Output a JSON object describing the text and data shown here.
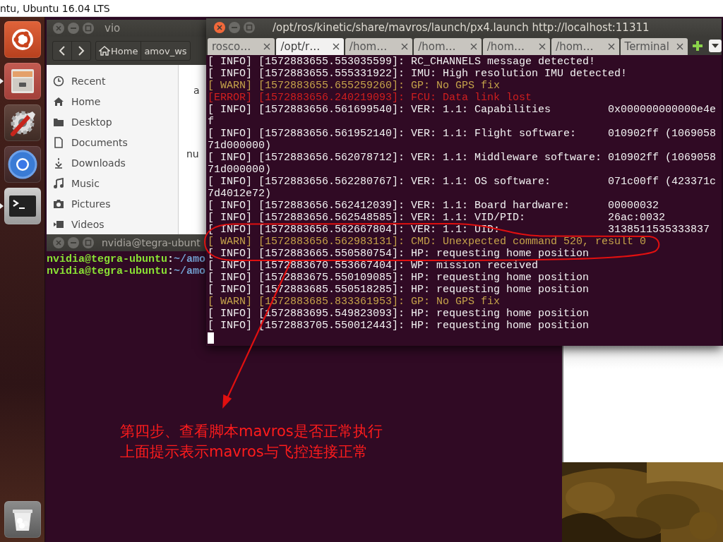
{
  "top_bar": {
    "title": "ntu, Ubuntu 16.04 LTS"
  },
  "launcher": {
    "items": [
      {
        "kind": "logo",
        "running": false
      },
      {
        "kind": "files",
        "running": true
      },
      {
        "kind": "settings",
        "running": false
      },
      {
        "kind": "browser",
        "running": false
      },
      {
        "kind": "terminal",
        "running": true
      },
      {
        "kind": "trash",
        "running": false
      }
    ]
  },
  "files_window": {
    "title": "vio",
    "path": [
      "Home",
      "amov_ws"
    ],
    "sidebar": [
      {
        "kind": "recent",
        "label": "Recent"
      },
      {
        "kind": "home",
        "label": "Home"
      },
      {
        "kind": "desktop",
        "label": "Desktop"
      },
      {
        "kind": "documents",
        "label": "Documents"
      },
      {
        "kind": "downloads",
        "label": "Downloads"
      },
      {
        "kind": "music",
        "label": "Music"
      },
      {
        "kind": "pictures",
        "label": "Pictures"
      },
      {
        "kind": "videos",
        "label": "Videos"
      }
    ],
    "file_labels": [
      "a",
      "nu"
    ]
  },
  "small_terminal": {
    "title": "nvidia@tegra-ubunt",
    "lines": [
      {
        "user": "nvidia@tegra-ubuntu",
        "separator": ":",
        "path": "~/amo"
      },
      {
        "user": "nvidia@tegra-ubuntu",
        "separator": ":",
        "path": "~/amo"
      }
    ]
  },
  "terminal": {
    "title": "/opt/ros/kinetic/share/mavros/launch/px4.launch http://localhost:11311",
    "tabs": [
      {
        "label": "rosco…",
        "selected": false
      },
      {
        "label": "/opt/r…",
        "selected": true
      },
      {
        "label": "/hom…",
        "selected": false
      },
      {
        "label": "/hom…",
        "selected": false
      },
      {
        "label": "/hom…",
        "selected": false
      },
      {
        "label": "/hom…",
        "selected": false
      },
      {
        "label": "Terminal",
        "selected": false
      }
    ],
    "lines": [
      {
        "kind": "info",
        "text": "[ INFO] [1572883655.553035599]: RC_CHANNELS message detected!"
      },
      {
        "kind": "info",
        "text": "[ INFO] [1572883655.555331922]: IMU: High resolution IMU detected!"
      },
      {
        "kind": "warn",
        "text": "[ WARN] [1572883655.655259260]: GP: No GPS fix"
      },
      {
        "kind": "error",
        "text": "[ERROR] [1572883656.240219093]: FCU: Data link lost"
      },
      {
        "kind": "info",
        "text": "[ INFO] [1572883656.561699540]: VER: 1.1: Capabilities         0x000000000000e4ef"
      },
      {
        "kind": "info",
        "text": "[ INFO] [1572883656.561952140]: VER: 1.1: Flight software:     010902ff (106905871d000000)"
      },
      {
        "kind": "info",
        "text": "[ INFO] [1572883656.562078712]: VER: 1.1: Middleware software: 010902ff (106905871d000000)"
      },
      {
        "kind": "info",
        "text": "[ INFO] [1572883656.562280767]: VER: 1.1: OS software:         071c00ff (423371c7d4012e72)"
      },
      {
        "kind": "info",
        "text": "[ INFO] [1572883656.562412039]: VER: 1.1: Board hardware:      00000032"
      },
      {
        "kind": "info",
        "text": "[ INFO] [1572883656.562548585]: VER: 1.1: VID/PID:             26ac:0032"
      },
      {
        "kind": "info",
        "text": "[ INFO] [1572883656.562667804]: VER: 1.1: UID:                 3138511535333837"
      },
      {
        "kind": "warn",
        "text": "[ WARN] [1572883656.562983131]: CMD: Unexpected command 520, result 0"
      },
      {
        "kind": "info",
        "text": "[ INFO] [1572883665.550580754]: HP: requesting home position"
      },
      {
        "kind": "info",
        "text": "[ INFO] [1572883670.553667404]: WP: mission received"
      },
      {
        "kind": "info",
        "text": "[ INFO] [1572883675.550109085]: HP: requesting home position"
      },
      {
        "kind": "info",
        "text": "[ INFO] [1572883685.550518285]: HP: requesting home position"
      },
      {
        "kind": "warn",
        "text": "[ WARN] [1572883685.833361953]: GP: No GPS fix"
      },
      {
        "kind": "info",
        "text": "[ INFO] [1572883695.549823093]: HP: requesting home position"
      },
      {
        "kind": "info",
        "text": "[ INFO] [1572883705.550012443]: HP: requesting home position"
      }
    ],
    "cursor": true
  },
  "annotation": {
    "lines": [
      "第四步、查看脚本mavros是否正常执行",
      "上面提示表示mavros与飞控连接正常"
    ]
  }
}
